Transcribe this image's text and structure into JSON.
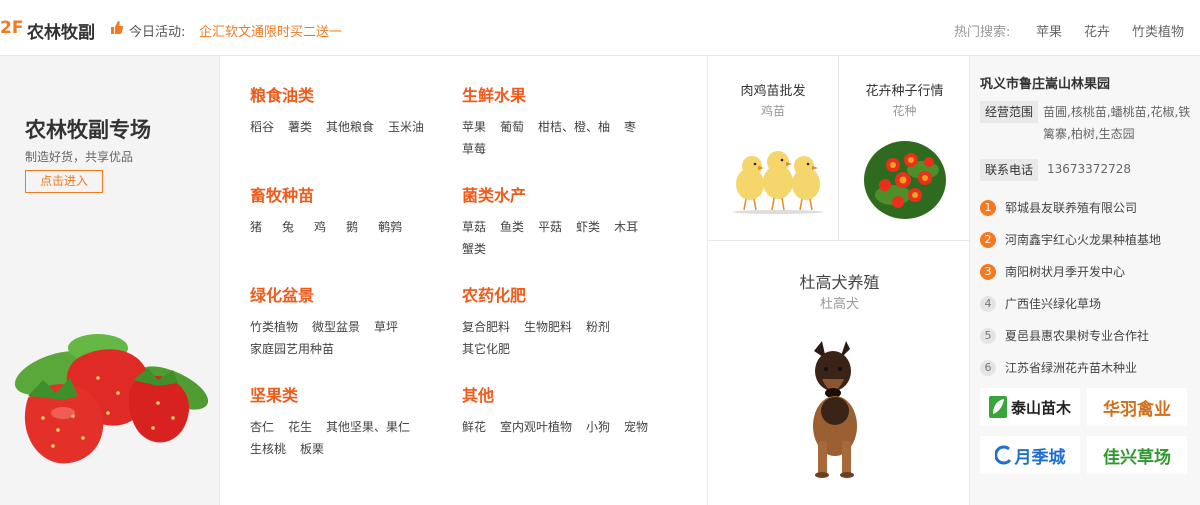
{
  "header": {
    "floor_num": "2F",
    "floor_title": "农林牧副",
    "activity_label": "今日活动:",
    "activity_text": "企汇软文通限时买二送一",
    "hot_label": "热门搜索:",
    "hot_items": [
      "苹果",
      "花卉",
      "竹类植物"
    ]
  },
  "promo": {
    "title": "农林牧副专场",
    "subtitle": "制造好货，共享优品",
    "button": "点击进入"
  },
  "categories": [
    {
      "title": "粮食油类",
      "items": [
        "稻谷",
        "薯类",
        "其他粮食",
        "玉米油"
      ]
    },
    {
      "title": "生鲜水果",
      "items": [
        "苹果",
        "葡萄",
        "柑桔、橙、柚",
        "枣",
        "草莓"
      ]
    },
    {
      "title": "畜牧种苗",
      "items": [
        "猪",
        "兔",
        "鸡",
        "鹅",
        "鹌鹑"
      ]
    },
    {
      "title": "菌类水产",
      "items": [
        "草菇",
        "鱼类",
        "平菇",
        "虾类",
        "木耳",
        "蟹类"
      ]
    },
    {
      "title": "绿化盆景",
      "items": [
        "竹类植物",
        "微型盆景",
        "草坪",
        "家庭园艺用种苗"
      ]
    },
    {
      "title": "农药化肥",
      "items": [
        "复合肥料",
        "生物肥料",
        "粉剂",
        "其它化肥"
      ]
    },
    {
      "title": "坚果类",
      "items": [
        "杏仁",
        "花生",
        "其他坚果、果仁",
        "生核桃",
        "板栗"
      ]
    },
    {
      "title": "其他",
      "items": [
        "鲜花",
        "室内观叶植物",
        "小狗",
        "宠物"
      ]
    }
  ],
  "cards": [
    {
      "title": "肉鸡苗批发",
      "sub": "鸡苗"
    },
    {
      "title": "花卉种子行情",
      "sub": "花种"
    },
    {
      "title": "杜高犬养殖",
      "sub": "杜高犬"
    }
  ],
  "company": {
    "name": "巩义市鲁庄嵩山林果园",
    "scope_label": "经营范围",
    "scope_text": "苗圃,核桃苗,蟠桃苗,花椒,铁篱寨,柏树,生态园",
    "phone_label": "联系电话",
    "phone": "13673372728"
  },
  "ranking": [
    {
      "num": "1",
      "text": "郓城县友联养殖有限公司"
    },
    {
      "num": "2",
      "text": "河南鑫宇红心火龙果种植基地"
    },
    {
      "num": "3",
      "text": "南阳树状月季开发中心"
    },
    {
      "num": "4",
      "text": "广西佳兴绿化草场"
    },
    {
      "num": "5",
      "text": "夏邑县惠农果树专业合作社"
    },
    {
      "num": "6",
      "text": "江苏省绿洲花卉苗木种业"
    }
  ],
  "brands": [
    "泰山苗木",
    "华羽禽业",
    "月季城",
    "佳兴草场"
  ],
  "colors": {
    "accent": "#f47a20",
    "category_title": "#f05a1a"
  }
}
